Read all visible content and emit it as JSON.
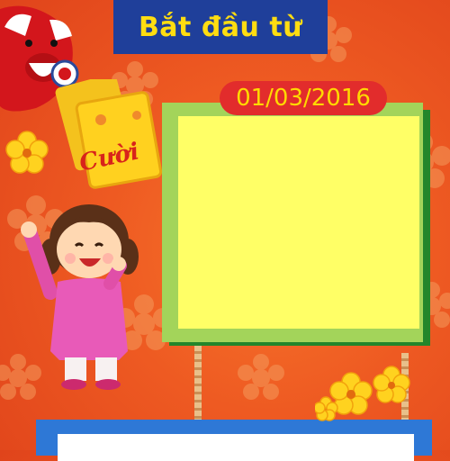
{
  "banner": {
    "title": "Bắt đầu từ"
  },
  "date": {
    "label": "01/03/2016"
  },
  "envelope": {
    "text": "Cười"
  },
  "colors": {
    "background": "#ee5a22",
    "banner": "#1f3f9a",
    "banner_text": "#ffdd11",
    "date_pill": "#e22c2c",
    "date_text": "#ffd900",
    "board_face": "#ffff66",
    "board_border": "#a3d45a",
    "board_shadow": "#23862b",
    "bottom_panel": "#2e78d6"
  },
  "icons": [
    "laughing-cow-logo-icon",
    "red-envelope-icon",
    "apricot-flower-icon",
    "girl-illustration-icon"
  ]
}
